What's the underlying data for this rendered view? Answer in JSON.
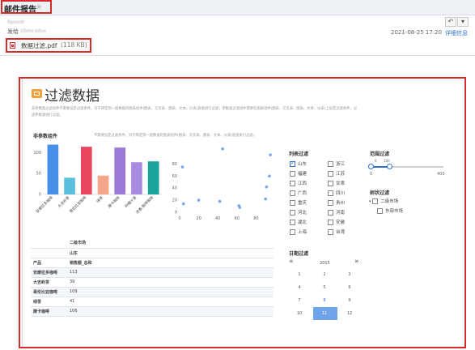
{
  "mail": {
    "title": "邮件报告",
    "sender_name": "Rpovdr",
    "to_label": "发给",
    "to_value": "zlbmcxdvx",
    "datetime": "2021-08-25 17:20",
    "detail_link": "详细信息"
  },
  "attachment": {
    "name": "数据过滤.pdf",
    "size": "(118 KB)"
  },
  "report": {
    "title": "过滤数据",
    "desc1": "非参数类过滤组件不需要设定过滤条件，对于绑定到一般数据的图表组件(图表、交叉表、图表、文本、仪表)直接进行过滤；参数类过滤组件需要在图表组件(图表、交叉表、图表、文本、仪表)上设定过滤条件，过",
    "desc2": "滤参数源进行过滤。",
    "chart_title": "非参数组件",
    "chart_note": "不需要设定过滤条件，对于绑定到一般数据的图表组件(图表、交叉表、图表、文本、仪表)直接进行过滤。"
  },
  "chart_data": [
    {
      "type": "bar",
      "title": "非参数组件",
      "categories": [
        "安摩拉多咖啡",
        "大吉岭茶",
        "哥伦比亚咖啡",
        "绿茶",
        "摩卡咖啡",
        "柠檬汁茶",
        "浓香.咖啡咖啡"
      ],
      "values": [
        119,
        40,
        114,
        45,
        112,
        77,
        79
      ],
      "colors": [
        "#4a8fe7",
        "#5bc0de",
        "#e8475f",
        "#f4a58a",
        "#9b7ad6",
        "#a98ce0",
        "#1aa39a"
      ],
      "ylim": [
        0,
        120
      ],
      "yticks": [
        0,
        50,
        100
      ]
    },
    {
      "type": "scatter",
      "x": [
        45,
        3,
        4,
        20,
        42,
        62,
        63,
        90,
        91,
        94,
        95
      ],
      "y": [
        105,
        75,
        14,
        20,
        18,
        11,
        8,
        22,
        42,
        60,
        95
      ],
      "xlim": [
        0,
        100
      ],
      "ylim": [
        0,
        110
      ],
      "xticks": [
        0,
        20,
        40,
        60,
        80
      ],
      "yticks": [
        0,
        20,
        40,
        60,
        80
      ],
      "point_color": "#7aa7e8"
    }
  ],
  "list_filter": {
    "title": "列表过滤",
    "left": [
      "山东",
      "福建",
      "江西",
      "广西",
      "重庆",
      "河北",
      "湖北",
      "上海"
    ],
    "right": [
      "浙江",
      "江苏",
      "甘肃",
      "四川",
      "贵州",
      "河南",
      "安徽",
      "台湾"
    ],
    "checked": "山东"
  },
  "range_filter": {
    "title": "范围过滤",
    "low": "0",
    "high": "100",
    "min": "0",
    "max": "400"
  },
  "tree_filter": {
    "title": "树状过滤",
    "root": "二级市场",
    "child": "东部市场"
  },
  "date_filter": {
    "title": "日期过滤",
    "prev": "«",
    "next": "»",
    "year": "2015",
    "months": [
      "1",
      "2",
      "3",
      "4",
      "5",
      "6",
      "7",
      "8",
      "9",
      "10",
      "11",
      "12"
    ],
    "selected": "11"
  },
  "pivot": {
    "header1": "二级市场",
    "header2": "山东",
    "row_header": "产品",
    "measure": "销售额_总和",
    "rows": [
      {
        "name": "安摩拉多咖啡",
        "value": "113"
      },
      {
        "name": "大吉岭茶",
        "value": "39"
      },
      {
        "name": "哥伦比亚咖啡",
        "value": "109"
      },
      {
        "name": "绿茶",
        "value": "41"
      },
      {
        "name": "摩卡咖啡",
        "value": "106"
      }
    ]
  }
}
